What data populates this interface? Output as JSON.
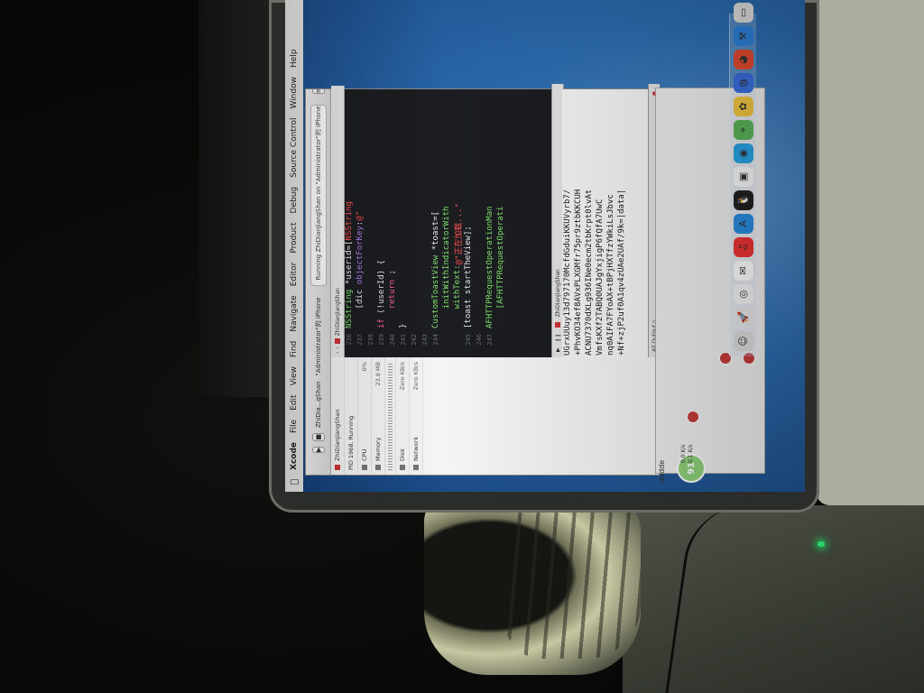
{
  "menubar": {
    "apple": "",
    "app": "Xcode",
    "items": [
      "File",
      "Edit",
      "View",
      "Find",
      "Navigate",
      "Editor",
      "Product",
      "Debug",
      "Source Control",
      "Window",
      "Help"
    ]
  },
  "xcode": {
    "status": "Running ZhiDianJiangShan on \"Administrator\"的 iPhone",
    "scheme": "ZhiDia...gShan",
    "device": "\"Administrator\"的 iPhone",
    "jump_file": "ZhiDianJiangShan",
    "navigator": {
      "title": "ZhiDianJiangShan",
      "pid": "PID 1968, Running",
      "cpu_label": "CPU",
      "cpu_value": "0%",
      "memory_label": "Memory",
      "memory_value": "23.8 MB",
      "disk_label": "Disk",
      "disk_value": "Zero KB/s",
      "network_label": "Network",
      "network_value": "Zero KB/s"
    },
    "code_lines": [
      {
        "n": "236",
        "seg": [
          {
            "c": "cls",
            "t": "NSString"
          },
          {
            "c": "tx",
            "t": " *userid=["
          },
          {
            "c": "str",
            "t": "NSString"
          }
        ]
      },
      {
        "n": "237",
        "seg": [
          {
            "c": "tx",
            "t": "    [dic "
          },
          {
            "c": "obj",
            "t": "objectForKey"
          },
          {
            "c": "tx",
            "t": ":"
          },
          {
            "c": "str",
            "t": "@\""
          }
        ]
      },
      {
        "n": "238",
        "seg": [
          {
            "c": "tx",
            "t": ""
          }
        ]
      },
      {
        "n": "239",
        "seg": [
          {
            "c": "kw",
            "t": "if"
          },
          {
            "c": "tx",
            "t": " (!userId) {"
          }
        ]
      },
      {
        "n": "240",
        "seg": [
          {
            "c": "tx",
            "t": "    "
          },
          {
            "c": "kw",
            "t": "return"
          },
          {
            "c": "tx",
            "t": " ;"
          }
        ]
      },
      {
        "n": "241",
        "seg": [
          {
            "c": "tx",
            "t": "}"
          }
        ]
      },
      {
        "n": "242",
        "seg": [
          {
            "c": "tx",
            "t": ""
          }
        ]
      },
      {
        "n": "243",
        "seg": [
          {
            "c": "tx",
            "t": ""
          }
        ]
      },
      {
        "n": "244",
        "seg": [
          {
            "c": "cls",
            "t": "CustomToastView"
          },
          {
            "c": "tx",
            "t": " *toast=["
          }
        ]
      },
      {
        "n": "",
        "seg": [
          {
            "c": "cls",
            "t": "    initWithIndicatorWith"
          }
        ]
      },
      {
        "n": "",
        "seg": [
          {
            "c": "cls",
            "t": "    withText:"
          },
          {
            "c": "str",
            "t": "@\"正在加载...\""
          }
        ]
      },
      {
        "n": "245",
        "seg": [
          {
            "c": "tx",
            "t": "[toast startTheView];"
          }
        ]
      },
      {
        "n": "246",
        "seg": [
          {
            "c": "tx",
            "t": ""
          }
        ]
      },
      {
        "n": "247",
        "seg": [
          {
            "c": "cls",
            "t": "AFHTTPRequestOperationMan"
          }
        ]
      },
      {
        "n": "",
        "seg": [
          {
            "c": "cls",
            "t": "    [AFHTTPRequestOperati"
          }
        ]
      }
    ],
    "debug_target": "ZhiDianJiangShan",
    "console": [
      "UGrxUUuy13d797170McfdGduiKKUVyrb7/",
      "+PhvKO34ef8AVxPLXGMfr75pr9ztbKKCUH",
      "ACNU7370dXLg936INe0ecm2tbKrpt0lvAt",
      "VmfsKXf2TABQ0UAJgYxjigP6fQfA7UwC",
      "nq0AIFA7FYoAX+tBPjHXTfzYWkiLsJbvc",
      "+Nf+zjP2uf0A1qv4zUAe2UAf/9k=|data|"
    ],
    "console_filter": "All Output ◊"
  },
  "overlay": {
    "app_tag": "dddde",
    "progress": "91",
    "speed_up": "0.0 K/s",
    "speed_down": "0.1 K/s"
  },
  "dock": {
    "icons": [
      "finder-icon",
      "launchpad-icon",
      "chrome-icon",
      "mail-icon",
      "music-icon",
      "appstore-icon",
      "qq-icon",
      "preview-icon",
      "safari-icon",
      "maps-icon",
      "photos-icon",
      "baidu-icon",
      "weibo-icon",
      "xcode-icon",
      "folder-icon"
    ]
  }
}
